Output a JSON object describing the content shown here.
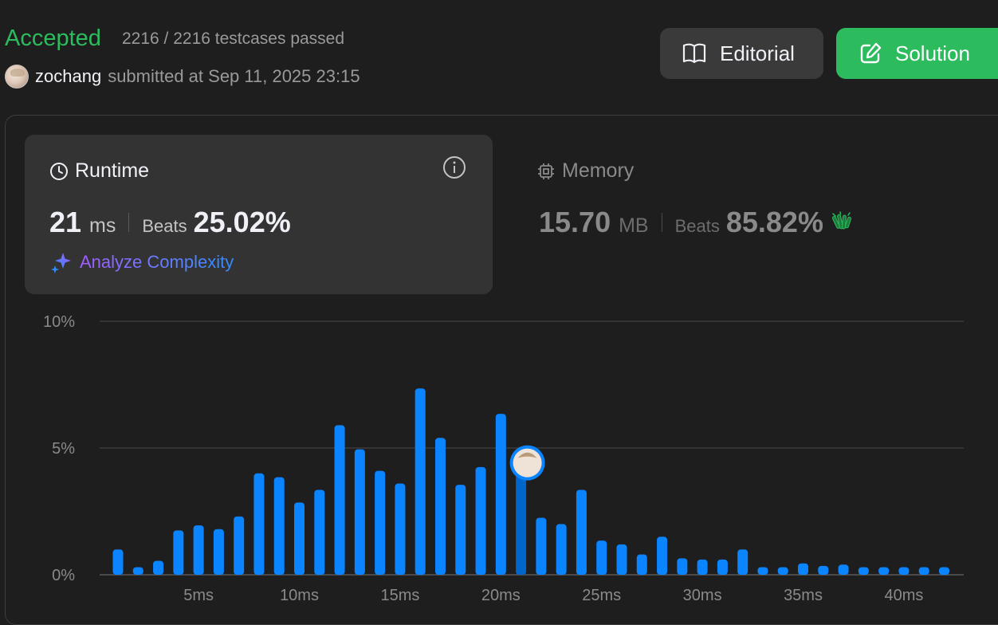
{
  "header": {
    "status": "Accepted",
    "testcases": "2216 / 2216 testcases passed",
    "username": "zochang",
    "submitted_text": "submitted at Sep 11, 2025 23:15"
  },
  "buttons": {
    "editorial": "Editorial",
    "solution": "Solution"
  },
  "runtime": {
    "title": "Runtime",
    "value": "21",
    "unit": "ms",
    "beats_label": "Beats",
    "beats_pct": "25.02%",
    "analyze_label": "Analyze Complexity"
  },
  "memory": {
    "title": "Memory",
    "value": "15.70",
    "unit": "MB",
    "beats_label": "Beats",
    "beats_pct": "85.82%"
  },
  "colors": {
    "accepted": "#2cbb5d",
    "bar": "#0a84ff",
    "bar_selected": "#0066cc",
    "solution_button": "#2cbb5d"
  },
  "chart_data": {
    "type": "bar",
    "xlabel": "",
    "ylabel": "",
    "ylim": [
      0,
      10
    ],
    "y_ticks": [
      0,
      5,
      10
    ],
    "y_tick_labels": [
      "0%",
      "5%",
      "10%"
    ],
    "x_tick_values": [
      5,
      10,
      15,
      20,
      25,
      30,
      35,
      40
    ],
    "x_tick_labels": [
      "5ms",
      "10ms",
      "15ms",
      "20ms",
      "25ms",
      "30ms",
      "35ms",
      "40ms"
    ],
    "x": [
      1,
      2,
      3,
      4,
      5,
      6,
      7,
      8,
      9,
      10,
      11,
      12,
      13,
      14,
      15,
      16,
      17,
      18,
      19,
      20,
      21,
      22,
      23,
      24,
      25,
      26,
      27,
      28,
      29,
      30,
      31,
      32,
      33,
      34,
      35,
      36,
      37,
      38,
      39,
      40,
      41,
      42
    ],
    "values": [
      1.0,
      0.3,
      0.55,
      1.75,
      1.95,
      1.8,
      2.3,
      4.0,
      3.85,
      2.85,
      3.35,
      5.9,
      4.95,
      4.1,
      3.6,
      7.35,
      5.4,
      3.55,
      4.25,
      6.35,
      4.1,
      2.25,
      2.0,
      3.35,
      1.35,
      1.2,
      0.8,
      1.5,
      0.65,
      0.6,
      0.6,
      1.0,
      0.3,
      0.3,
      0.45,
      0.35,
      0.4,
      0.3,
      0.3,
      0.3,
      0.3,
      0.3
    ],
    "selected_x": 21,
    "grid": true
  }
}
